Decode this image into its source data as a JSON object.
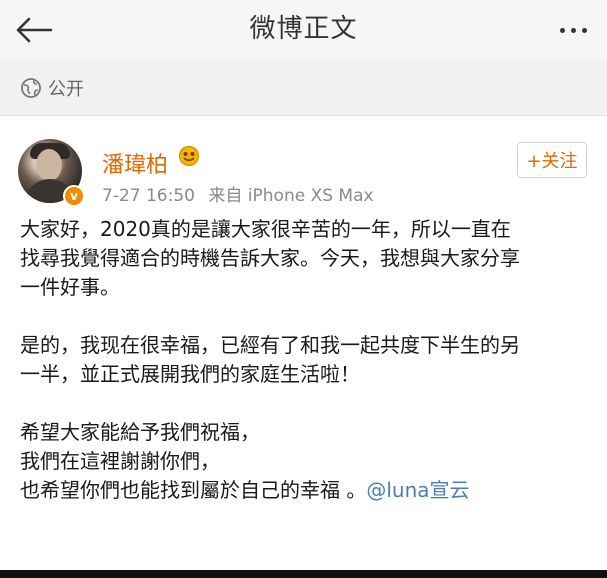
{
  "header": {
    "title": "微博正文",
    "back_icon": "back-arrow-icon",
    "more_icon": "more-dots-icon"
  },
  "visibility": {
    "label": "公开",
    "icon": "globe-icon"
  },
  "post": {
    "author": "潘瑋柏",
    "author_color": "#e06a00",
    "timestamp": "7-27 16:50",
    "source": "来自 iPhone XS Max",
    "follow_label": "+关注",
    "paragraphs": [
      [
        "大家好，2020真的是讓大家很辛苦的一年，所以一直在",
        "找尋我覺得適合的時機告訴大家。今天，我想與大家分享",
        "一件好事。"
      ],
      [
        "是的，我现在很幸福，已經有了和我一起共度下半生的另",
        "一半，並正式展開我們的家庭生活啦！"
      ],
      [
        "希望大家能給予我們祝福，",
        "我們在這裡謝謝你們，",
        "也希望你們也能找到屬於自己的幸福 。"
      ]
    ],
    "mention": "@luna宣云"
  }
}
